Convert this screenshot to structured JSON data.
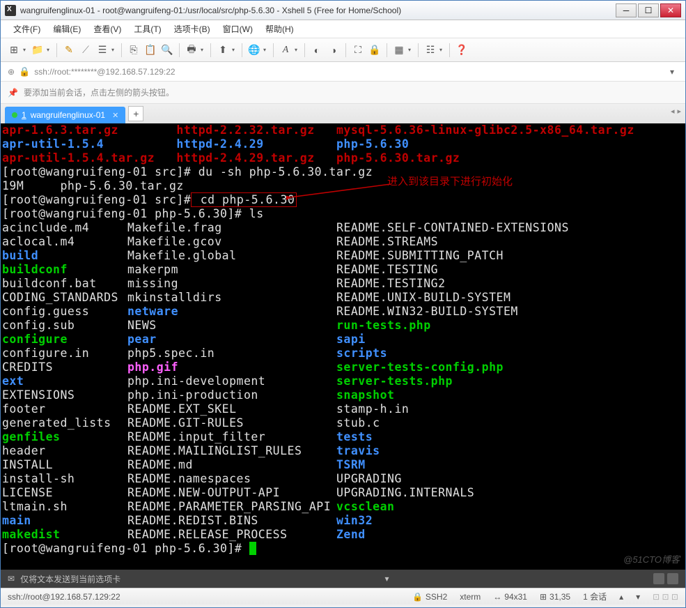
{
  "window": {
    "title": "wangruifenglinux-01 - root@wangruifeng-01:/usr/local/src/php-5.6.30 - Xshell 5 (Free for Home/School)"
  },
  "menubar": [
    "文件(F)",
    "编辑(E)",
    "查看(V)",
    "工具(T)",
    "选项卡(B)",
    "窗口(W)",
    "帮助(H)"
  ],
  "addressbar": {
    "url": "ssh://root:********@192.168.57.129:22"
  },
  "infobar": {
    "text": "要添加当前会话，点击左侧的箭头按钮。"
  },
  "tab": {
    "number": "1",
    "title": "wangruifenglinux-01"
  },
  "terminal": {
    "top_files": {
      "row1": [
        "apr-1.6.3.tar.gz",
        "httpd-2.2.32.tar.gz",
        "mysql-5.6.36-linux-glibc2.5-x86_64.tar.gz"
      ],
      "row2": [
        "apr-util-1.5.4",
        "httpd-2.4.29",
        "php-5.6.30"
      ],
      "row3": [
        "apr-util-1.5.4.tar.gz",
        "httpd-2.4.29.tar.gz",
        "php-5.6.30.tar.gz"
      ]
    },
    "prompt1_user": "[root@wangruifeng-01 src]#",
    "cmd1": " du -sh php-5.6.30.tar.gz",
    "out1": "19M     php-5.6.30.tar.gz",
    "prompt2_user": "[root@wangruifeng-01 src]#",
    "cmd2": " cd php-5.6.30",
    "annotation": "进入到该目录下进行初始化",
    "prompt3_user": "[root@wangruifeng-01 php-5.6.30]#",
    "cmd3": " ls",
    "ls_rows": [
      [
        "acinclude.m4",
        "w",
        "Makefile.frag",
        "w",
        "README.SELF-CONTAINED-EXTENSIONS",
        "w"
      ],
      [
        "aclocal.m4",
        "w",
        "Makefile.gcov",
        "w",
        "README.STREAMS",
        "w"
      ],
      [
        "build",
        "b",
        "Makefile.global",
        "w",
        "README.SUBMITTING_PATCH",
        "w"
      ],
      [
        "buildconf",
        "g",
        "makerpm",
        "w",
        "README.TESTING",
        "w"
      ],
      [
        "buildconf.bat",
        "w",
        "missing",
        "w",
        "README.TESTING2",
        "w"
      ],
      [
        "CODING_STANDARDS",
        "w",
        "mkinstalldirs",
        "w",
        "README.UNIX-BUILD-SYSTEM",
        "w"
      ],
      [
        "config.guess",
        "w",
        "netware",
        "b",
        "README.WIN32-BUILD-SYSTEM",
        "w"
      ],
      [
        "config.sub",
        "w",
        "NEWS",
        "w",
        "run-tests.php",
        "g"
      ],
      [
        "configure",
        "g",
        "pear",
        "b",
        "sapi",
        "b"
      ],
      [
        "configure.in",
        "w",
        "php5.spec.in",
        "w",
        "scripts",
        "b"
      ],
      [
        "CREDITS",
        "w",
        "php.gif",
        "m",
        "server-tests-config.php",
        "g"
      ],
      [
        "ext",
        "b",
        "php.ini-development",
        "w",
        "server-tests.php",
        "g"
      ],
      [
        "EXTENSIONS",
        "w",
        "php.ini-production",
        "w",
        "snapshot",
        "g"
      ],
      [
        "footer",
        "w",
        "README.EXT_SKEL",
        "w",
        "stamp-h.in",
        "w"
      ],
      [
        "generated_lists",
        "w",
        "README.GIT-RULES",
        "w",
        "stub.c",
        "w"
      ],
      [
        "genfiles",
        "g",
        "README.input_filter",
        "w",
        "tests",
        "b"
      ],
      [
        "header",
        "w",
        "README.MAILINGLIST_RULES",
        "w",
        "travis",
        "b"
      ],
      [
        "INSTALL",
        "w",
        "README.md",
        "w",
        "TSRM",
        "b"
      ],
      [
        "install-sh",
        "w",
        "README.namespaces",
        "w",
        "UPGRADING",
        "w"
      ],
      [
        "LICENSE",
        "w",
        "README.NEW-OUTPUT-API",
        "w",
        "UPGRADING.INTERNALS",
        "w"
      ],
      [
        "ltmain.sh",
        "w",
        "README.PARAMETER_PARSING_API",
        "w",
        "vcsclean",
        "g"
      ],
      [
        "main",
        "b",
        "README.REDIST.BINS",
        "w",
        "win32",
        "b"
      ],
      [
        "makedist",
        "g",
        "README.RELEASE_PROCESS",
        "w",
        "Zend",
        "b"
      ]
    ],
    "prompt4_user": "[root@wangruifeng-01 php-5.6.30]#"
  },
  "footer_msg": "仅将文本发送到当前选项卡",
  "statusbar": {
    "conn": "ssh://root@192.168.57.129:22",
    "ssh": "SSH2",
    "term": "xterm",
    "size": "94x31",
    "pos": "31,35",
    "sessions": "1 会话"
  },
  "watermark": "@51CTO博客"
}
